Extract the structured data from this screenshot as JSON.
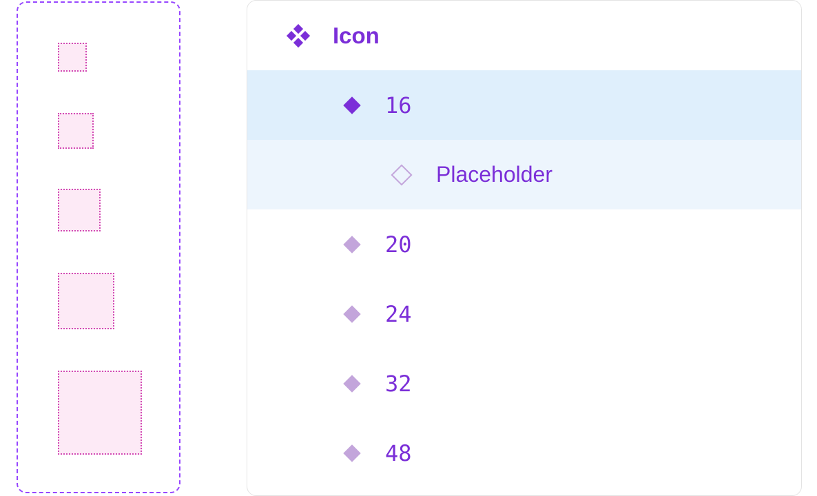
{
  "colors": {
    "accent": "#7b2fd8",
    "component_frame": "#9747ff",
    "variant_muted": "#c3a5db",
    "selected_row": "#dfeffc",
    "child_selected_row": "#edf5fd",
    "placeholder_fill": "#fdeaf6",
    "placeholder_border": "#d24bb4"
  },
  "canvas": {
    "variants": [
      "16",
      "20",
      "24",
      "32",
      "48"
    ]
  },
  "layers": {
    "root": {
      "label": "Icon",
      "icon": "component-set-icon"
    },
    "items": [
      {
        "label": "16",
        "icon": "component-icon",
        "state": "selected"
      },
      {
        "label": "Placeholder",
        "icon": "instance-icon",
        "state": "child"
      },
      {
        "label": "20",
        "icon": "component-icon",
        "state": "default"
      },
      {
        "label": "24",
        "icon": "component-icon",
        "state": "default"
      },
      {
        "label": "32",
        "icon": "component-icon",
        "state": "default"
      },
      {
        "label": "48",
        "icon": "component-icon",
        "state": "default"
      }
    ]
  }
}
